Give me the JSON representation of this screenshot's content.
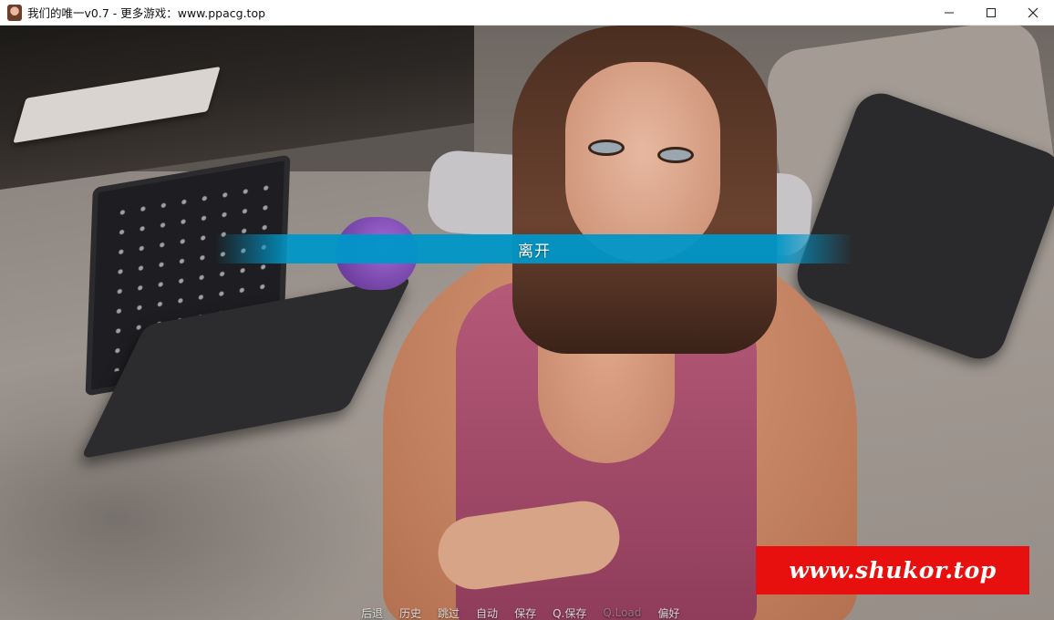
{
  "window": {
    "title": "我们的唯一v0.7 - 更多游戏：www.ppacg.top",
    "app_icon": "character-portrait-icon",
    "controls": {
      "minimize_icon": "minimize-icon",
      "maximize_icon": "maximize-icon",
      "close_icon": "close-icon"
    }
  },
  "scene": {
    "description_objects": [
      "bed",
      "laptop",
      "book",
      "pillows",
      "character"
    ]
  },
  "choice_menu": {
    "options": [
      {
        "label": "离开"
      }
    ],
    "color": "#0096c8"
  },
  "watermark": {
    "text": "www.shukor.top",
    "background": "#e8100e"
  },
  "quick_menu": {
    "items": [
      {
        "label": "后退",
        "enabled": true
      },
      {
        "label": "历史",
        "enabled": true
      },
      {
        "label": "跳过",
        "enabled": true
      },
      {
        "label": "自动",
        "enabled": true
      },
      {
        "label": "保存",
        "enabled": true
      },
      {
        "label": "Q.保存",
        "enabled": true
      },
      {
        "label": "Q.Load",
        "enabled": false
      },
      {
        "label": "偏好",
        "enabled": true
      }
    ]
  }
}
